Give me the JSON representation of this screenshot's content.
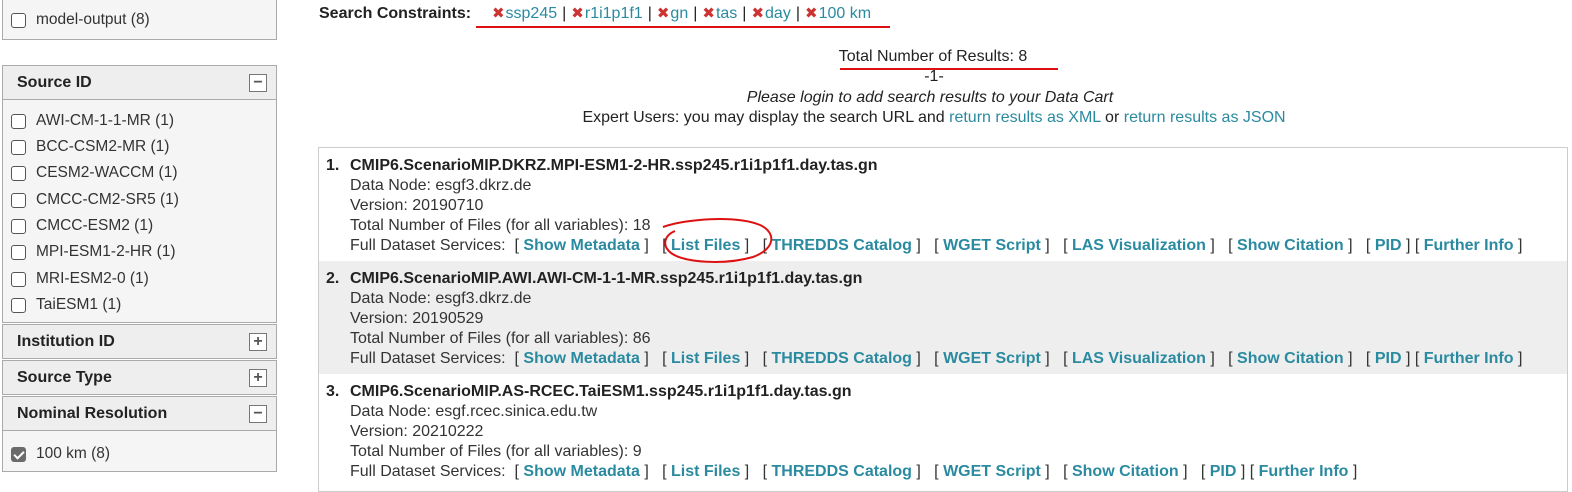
{
  "sidebar": {
    "top_item": {
      "label": "model-output (8)"
    },
    "source_id": {
      "title": "Source ID",
      "toggle": "−",
      "items": [
        {
          "label": "AWI-CM-1-1-MR (1)"
        },
        {
          "label": "BCC-CSM2-MR (1)"
        },
        {
          "label": "CESM2-WACCM (1)"
        },
        {
          "label": "CMCC-CM2-SR5 (1)"
        },
        {
          "label": "CMCC-ESM2 (1)"
        },
        {
          "label": "MPI-ESM1-2-HR (1)"
        },
        {
          "label": "MRI-ESM2-0 (1)"
        },
        {
          "label": "TaiESM1 (1)"
        }
      ]
    },
    "institution_id": {
      "title": "Institution ID",
      "toggle": "+"
    },
    "source_type": {
      "title": "Source Type",
      "toggle": "+"
    },
    "nominal_resolution": {
      "title": "Nominal Resolution",
      "toggle": "−",
      "items": [
        {
          "label": "100 km (8)",
          "checked": true
        }
      ]
    }
  },
  "constraints": {
    "label": "Search Constraints:",
    "items": [
      "ssp245",
      "r1i1p1f1",
      "gn",
      "tas",
      "day",
      "100 km"
    ],
    "separator": "|"
  },
  "summary": {
    "total": "Total Number of Results: 8",
    "page": "-1-",
    "login_note": "Please login to add search results to your Data Cart",
    "expert_prefix": "Expert Users: you may display the search URL and",
    "xml_link": "return results as XML",
    "or": "or",
    "json_link": "return results as JSON"
  },
  "results": [
    {
      "num": "1.",
      "title": "CMIP6.ScenarioMIP.DKRZ.MPI-ESM1-2-HR.ssp245.r1i1p1f1.day.tas.gn",
      "data_node": "Data Node: esgf3.dkrz.de",
      "version": "Version: 20190710",
      "files": "Total Number of Files (for all variables): 18",
      "services_label": "Full Dataset Services:",
      "services": [
        "Show Metadata",
        "List Files",
        "THREDDS Catalog",
        "WGET Script",
        "LAS Visualization",
        "Show Citation",
        "PID",
        "Further Info"
      ]
    },
    {
      "num": "2.",
      "title": "CMIP6.ScenarioMIP.AWI.AWI-CM-1-1-MR.ssp245.r1i1p1f1.day.tas.gn",
      "data_node": "Data Node: esgf3.dkrz.de",
      "version": "Version: 20190529",
      "files": "Total Number of Files (for all variables): 86",
      "services_label": "Full Dataset Services:",
      "services": [
        "Show Metadata",
        "List Files",
        "THREDDS Catalog",
        "WGET Script",
        "LAS Visualization",
        "Show Citation",
        "PID",
        "Further Info"
      ]
    },
    {
      "num": "3.",
      "title": "CMIP6.ScenarioMIP.AS-RCEC.TaiESM1.ssp245.r1i1p1f1.day.tas.gn",
      "data_node": "Data Node: esgf.rcec.sinica.edu.tw",
      "version": "Version: 20210222",
      "files": "Total Number of Files (for all variables): 9",
      "services_label": "Full Dataset Services:",
      "services": [
        "Show Metadata",
        "List Files",
        "THREDDS Catalog",
        "WGET Script",
        "Show Citation",
        "PID",
        "Further Info"
      ]
    }
  ],
  "colors": {
    "link": "#2a8aa0",
    "annotation_red": "#dd1111",
    "alt_row": "#eeeeee"
  }
}
